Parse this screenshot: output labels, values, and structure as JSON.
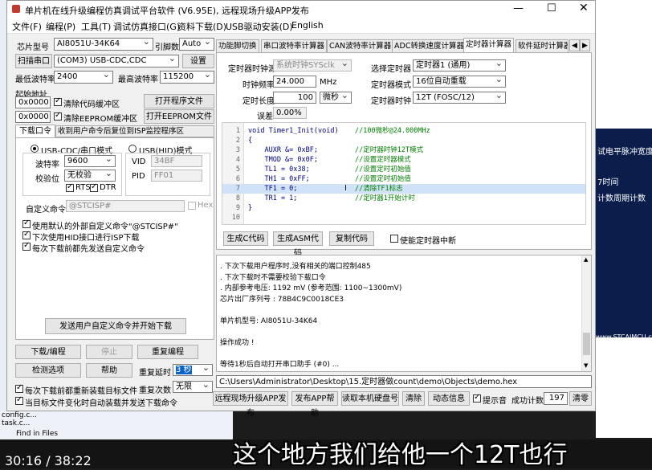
{
  "window": {
    "title": "单片机在线升级编程仿真调试平台软件 (V6.95E), 远程现场升级APP发布"
  },
  "menu": [
    "文件(F)",
    "编程(P)",
    "工具(T)",
    "调试仿真接口(G)",
    "资料下载(D)",
    "USB驱动安装(D)",
    "English"
  ],
  "left": {
    "chip_label": "芯片型号",
    "chip_value": "AI8051U-34K64",
    "ref_label": "引脚数",
    "ref_value": "Auto",
    "scan_btn": "扫描串口",
    "port_value": "(COM3) USB-CDC,CDC",
    "settings_btn": "设置",
    "min_baud_label": "最低波特率",
    "min_baud": "2400",
    "max_baud_label": "最高波特率",
    "max_baud": "115200",
    "start_addr_label": "起始地址",
    "addr1": "0x0000",
    "clear_code": "清除代码缓冲区",
    "open_prog": "打开程序文件",
    "addr2": "0x0000",
    "clear_eeprom": "清除EEPROM缓冲区",
    "open_eeprom": "打开EEPROM文件",
    "tab1": "下载口令",
    "tab2": "收到用户命令后复位到ISP监控程序区",
    "radio_cdc": "USB-CDC/串口模式",
    "radio_hid": "USB(HID)模式",
    "baud_label": "波特率",
    "baud_value": "9600",
    "parity_label": "校验位",
    "parity_value": "无校验",
    "rts": "RTS",
    "dtr": "DTR",
    "vid_label": "VID",
    "vid_value": "34BF",
    "pid_label": "PID",
    "pid_value": "FF01",
    "custom_cmd_label": "自定义命令",
    "custom_cmd_value": "@STCISP#",
    "hex_label": "Hex",
    "opt1": "使用默认的外部自定义命令\"@STCISP#\"",
    "opt2": "下次使用HID接口进行ISP下载",
    "opt3": "每次下载前都先发送自定义命令",
    "send_btn": "发送用户自定义命令并开始下载",
    "download_btn": "下载/编程",
    "stop_btn": "停止",
    "reprogram_btn": "重复编程",
    "detect_btn": "检测选项",
    "help_btn": "帮助",
    "delay_label": "重复延时",
    "delay_value": "3 秒",
    "reload_label": "每次下载前都重新装载目标文件",
    "repeat_label": "重复次数",
    "repeat_value": "无限",
    "auto_load_label": "当目标文件变化时自动装载并发送下载命令"
  },
  "tabs": [
    "功能脚切换",
    "串口波特率计算器",
    "CAN波特率计算器",
    "ADC转换速度计算器",
    "定时器计算器",
    "软件延时计算器"
  ],
  "timer": {
    "clock_label": "定时器时钟源",
    "clock_value": "系统时钟SYSclk",
    "select_label": "选择定时器",
    "select_value": "定时器1 (通用)",
    "freq_label": "时钟频率",
    "freq_value": "24.000",
    "freq_unit": "MHz",
    "mode_label": "定时器模式",
    "mode_value": "16位自动重载",
    "len_label": "定时长度",
    "len_value": "100",
    "len_unit": "微秒",
    "tclk_label": "定时器时钟",
    "tclk_value": "12T (FOSC/12)",
    "err_label": "误差",
    "err_value": "0.00%",
    "gen_c": "生成C代码",
    "gen_asm": "生成ASM代码",
    "copy": "复制代码",
    "enable_int": "使能定时器中断"
  },
  "code_lines": [
    {
      "n": "1",
      "c": "void Timer1_Init(void)",
      "m": "//100微秒@24.000MHz"
    },
    {
      "n": "2",
      "c": "{",
      "m": ""
    },
    {
      "n": "3",
      "c": "    AUXR &= 0xBF;",
      "m": "//定时器时钟12T模式"
    },
    {
      "n": "4",
      "c": "    TMOD &= 0x0F;",
      "m": "//设置定时器模式"
    },
    {
      "n": "5",
      "c": "    TL1 = 0x38;",
      "m": "//设置定时初始值"
    },
    {
      "n": "6",
      "c": "    TH1 = 0xFF;",
      "m": "//设置定时初始值"
    },
    {
      "n": "7",
      "c": "    TF1 = 0;",
      "m": "//清除TF1标志"
    },
    {
      "n": "8",
      "c": "    TR1 = 1;",
      "m": "//定时器1开始计时"
    },
    {
      "n": "9",
      "c": "}",
      "m": ""
    },
    {
      "n": "10",
      "c": "",
      "m": ""
    }
  ],
  "log_lines": [
    ". 下次下载用户程序时,没有相关的端口控制485",
    ". 下次下载时不需要校验下载口令",
    ". 内部参考电压: 1192 mV (参考范围: 1100~1300mV)",
    "芯片出厂序列号 : 78B4C9C0018CE3",
    "",
    "   单片机型号: AI8051U-34K64",
    "",
    "操作成功 !",
    "",
    "等待1秒后自动打开串口助手 (#0) ..."
  ],
  "bottom": {
    "path": "C:\\Users\\Administrator\\Desktop\\15.定时器做count\\demo\\Objects\\demo.hex",
    "btn_publish": "远程现场升级APP发布",
    "btn_app": "发布APP帮助",
    "btn_disk": "读取本机硬盘号",
    "btn_clear": "清除",
    "btn_anim": "动态信息",
    "hint_label": "提示音",
    "count_label": "成功计数",
    "count_value": "197",
    "btn_reset": "清零"
  },
  "right_bg": {
    "t1": "试电平脉冲宽度",
    "t2": "7时间",
    "t3": "计数周期计数",
    "url": "www.STCAIMCU.com"
  },
  "left_bg": [
    "config.c...",
    "task.c...",
    "Find in Files"
  ],
  "video_time": "30:16 / 38:22",
  "subtitle": "这个地方我们给他一个12T也行"
}
